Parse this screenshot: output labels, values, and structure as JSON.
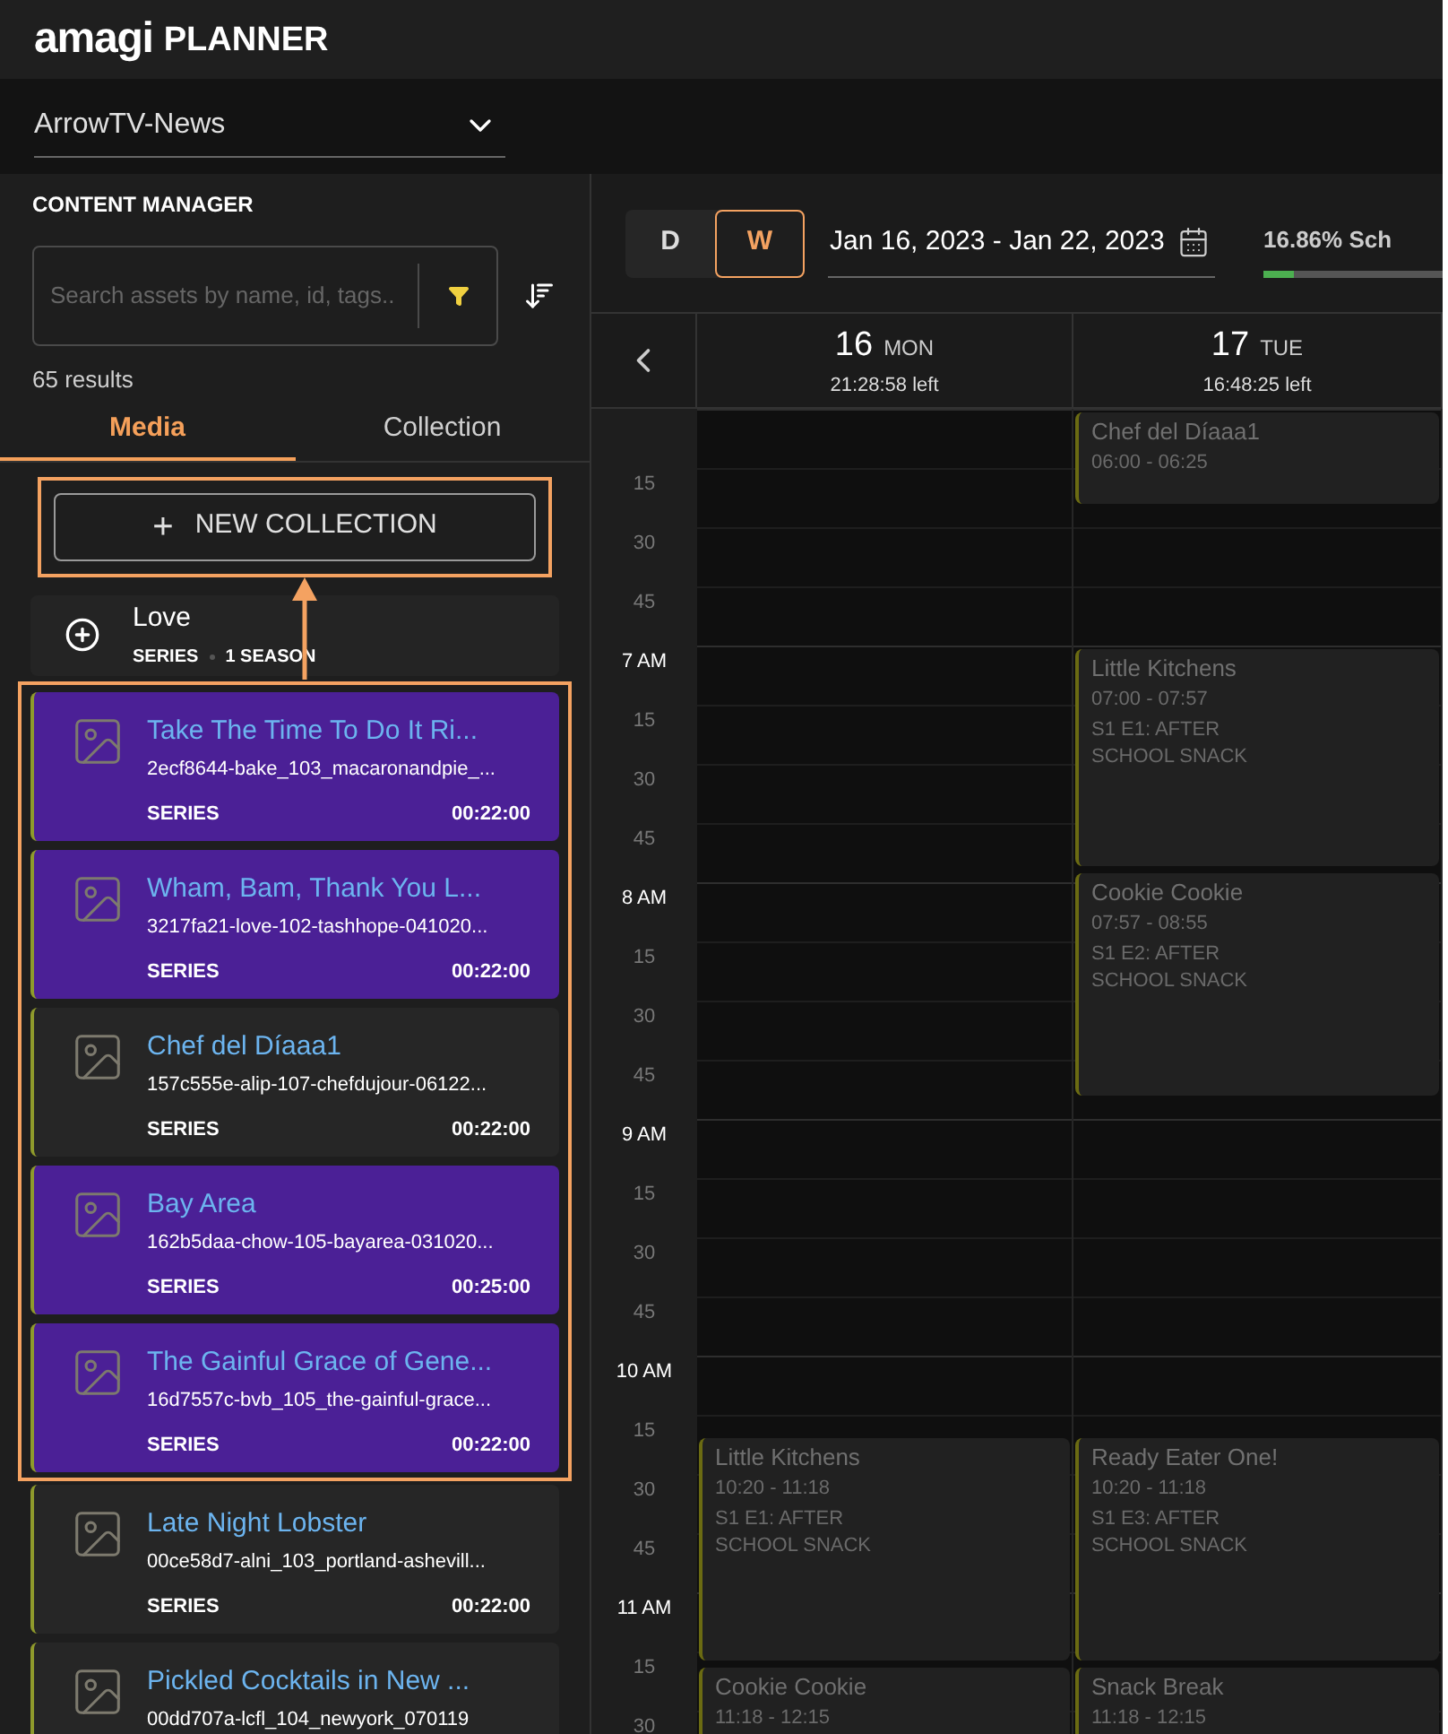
{
  "header": {
    "logo": "amagi",
    "title": "PLANNER"
  },
  "channel_select": {
    "value": "ArrowTV-News"
  },
  "content_manager": {
    "title": "CONTENT MANAGER",
    "search": {
      "placeholder": "Search assets by name, id, tags.."
    },
    "results": "65 results",
    "tabs": [
      {
        "label": "Media",
        "selected": true
      },
      {
        "label": "Collection",
        "selected": false
      }
    ],
    "new_collection_button": {
      "icon": "+",
      "label": "NEW COLLECTION"
    },
    "collection": {
      "title": "Love",
      "type": "SERIES",
      "seasons": "1 SEASON"
    },
    "assets": [
      {
        "title": "Take The Time To Do It Ri...",
        "id": "2ecf8644-bake_103_macaronandpie_...",
        "type": "SERIES",
        "duration": "00:22:00",
        "selected": true
      },
      {
        "title": "Wham, Bam, Thank You L...",
        "id": "3217fa21-love-102-tashhope-041020...",
        "type": "SERIES",
        "duration": "00:22:00",
        "selected": true
      },
      {
        "title": "Chef del Díaaa1",
        "id": "157c555e-alip-107-chefdujour-06122...",
        "type": "SERIES",
        "duration": "00:22:00",
        "selected": false
      },
      {
        "title": "Bay Area",
        "id": "162b5daa-chow-105-bayarea-031020...",
        "type": "SERIES",
        "duration": "00:25:00",
        "selected": true
      },
      {
        "title": "The Gainful Grace of Gene...",
        "id": "16d7557c-bvb_105_the-gainful-grace...",
        "type": "SERIES",
        "duration": "00:22:00",
        "selected": true
      },
      {
        "title": "Late Night Lobster",
        "id": "00ce58d7-alni_103_portland-ashevill...",
        "type": "SERIES",
        "duration": "00:22:00",
        "selected": false
      },
      {
        "title": "Pickled Cocktails in New ...",
        "id": "00dd707a-lcfl_104_newyork_070119",
        "selected": false
      }
    ]
  },
  "toolbar": {
    "views": [
      {
        "label": "D",
        "selected": false
      },
      {
        "label": "W",
        "selected": true
      }
    ],
    "date_range": "Jan 16, 2023 - Jan 22, 2023",
    "schedule_status": {
      "text": "16.86% Sch",
      "level": 0.1686
    }
  },
  "calendar": {
    "days": [
      {
        "number": "16",
        "weekday": "MON",
        "remaining": "21:28:58 left",
        "events": [
          {
            "title": "Little Kitchens",
            "time": "10:20 - 11:18",
            "episode": "S1 E1: AFTER SCHOOL SNACK"
          },
          {
            "title": "Cookie Cookie",
            "time": "11:18 - 12:15"
          }
        ]
      },
      {
        "number": "17",
        "weekday": "TUE",
        "remaining": "16:48:25 left",
        "events": [
          {
            "title": "Chef del Díaaa1",
            "time": "06:00 - 06:25"
          },
          {
            "title": "Little Kitchens",
            "time": "07:00 - 07:57",
            "episode": "S1 E1: AFTER SCHOOL SNACK"
          },
          {
            "title": "Cookie Cookie",
            "time": "07:57 - 08:55",
            "episode": "S1 E2: AFTER SCHOOL SNACK"
          },
          {
            "title": "Ready Eater One!",
            "time": "10:20 - 11:18",
            "episode": "S1 E3: AFTER SCHOOL SNACK"
          },
          {
            "title": "Snack Break",
            "time": "11:18 - 12:15"
          }
        ]
      }
    ],
    "time_labels": [
      {
        "text": "15",
        "kind": "minute"
      },
      {
        "text": "30",
        "kind": "minute"
      },
      {
        "text": "45",
        "kind": "minute"
      },
      {
        "text": "7 AM",
        "kind": "hour"
      },
      {
        "text": "15",
        "kind": "minute"
      },
      {
        "text": "30",
        "kind": "minute"
      },
      {
        "text": "45",
        "kind": "minute"
      },
      {
        "text": "8 AM",
        "kind": "hour"
      },
      {
        "text": "15",
        "kind": "minute"
      },
      {
        "text": "30",
        "kind": "minute"
      },
      {
        "text": "45",
        "kind": "minute"
      },
      {
        "text": "9 AM",
        "kind": "hour"
      },
      {
        "text": "15",
        "kind": "minute"
      },
      {
        "text": "30",
        "kind": "minute"
      },
      {
        "text": "45",
        "kind": "minute"
      },
      {
        "text": "10 AM",
        "kind": "hour"
      },
      {
        "text": "15",
        "kind": "minute"
      },
      {
        "text": "30",
        "kind": "minute"
      },
      {
        "text": "45",
        "kind": "minute"
      },
      {
        "text": "11 AM",
        "kind": "hour"
      },
      {
        "text": "15",
        "kind": "minute"
      },
      {
        "text": "30",
        "kind": "minute"
      }
    ]
  }
}
